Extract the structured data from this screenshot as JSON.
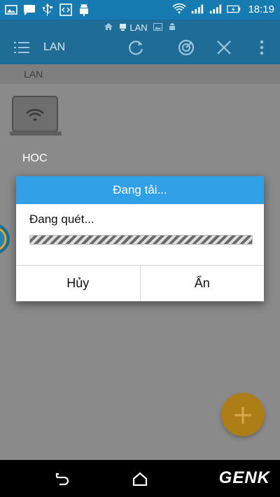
{
  "status_bar": {
    "time": "18:19",
    "icons_left": [
      "gallery-icon",
      "chat-icon",
      "usb-icon",
      "code-icon",
      "android-icon"
    ],
    "icons_right": [
      "wifi-icon",
      "signal-icon",
      "signal-icon-2",
      "battery-icon"
    ]
  },
  "breadcrumb_mini": {
    "current": "LAN"
  },
  "appbar": {
    "title": "LAN",
    "actions": [
      "refresh-icon",
      "scan-icon",
      "close-icon",
      "more-vert-icon"
    ]
  },
  "pathbar": {
    "segment": "LAN"
  },
  "hosts": [
    {
      "label": "HOC",
      "icon": "laptop-wifi-icon"
    }
  ],
  "dialog": {
    "title": "Đang tải...",
    "message": "Đang quét...",
    "cancel_label": "Hủy",
    "hide_label": "Ẩn"
  },
  "fab": {
    "symbol": "+"
  },
  "navbar": {
    "watermark": "GENK"
  },
  "colors": {
    "statusbar": "#167bb0",
    "appbar": "#1f6d97",
    "dialog_header": "#32a0e6",
    "fab": "#ad7e16",
    "background_dim": "#8a8a8a"
  }
}
